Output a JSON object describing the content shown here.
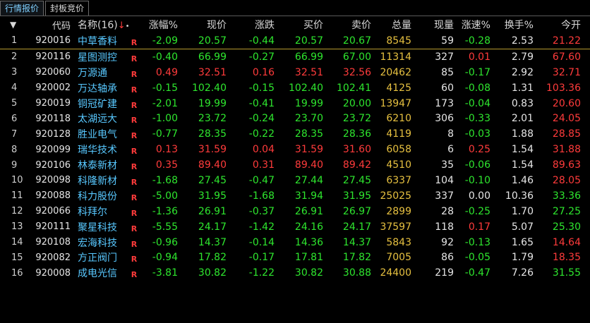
{
  "tabs": [
    {
      "label": "行情报价",
      "active": true
    },
    {
      "label": "封板竞价",
      "active": false
    }
  ],
  "header": {
    "sort_icon": "▼",
    "code": "代码",
    "name": "名称(16)",
    "sort_arrow": "↓",
    "dot": "•",
    "chg_pct": "涨幅%",
    "price": "现价",
    "diff": "涨跌",
    "bid": "买价",
    "ask": "卖价",
    "volume": "总量",
    "cur_vol": "现量",
    "speed": "涨速%",
    "turnover": "换手%",
    "open": "今开"
  },
  "colors": {
    "up": "#ff3b3b",
    "down": "#2ee62e",
    "name": "#58c8ff",
    "volume": "#e6c040",
    "selected_line": "#b69b2e"
  },
  "rows": [
    {
      "idx": "1",
      "code": "920016",
      "name": "中草香料",
      "flag": "R",
      "chg": "-2.09",
      "price": "20.57",
      "diff": "-0.44",
      "bid": "20.57",
      "ask": "20.67",
      "vol": "8545",
      "cur": "59",
      "spd": "-0.28",
      "turn": "2.53",
      "open": "21.22"
    },
    {
      "idx": "2",
      "code": "920116",
      "name": "星图测控",
      "flag": "R",
      "chg": "-0.40",
      "price": "66.99",
      "diff": "-0.27",
      "bid": "66.99",
      "ask": "67.00",
      "vol": "11314",
      "cur": "327",
      "spd": "0.01",
      "turn": "2.79",
      "open": "67.60"
    },
    {
      "idx": "3",
      "code": "920060",
      "name": "万源通",
      "flag": "R",
      "chg": "0.49",
      "price": "32.51",
      "diff": "0.16",
      "bid": "32.51",
      "ask": "32.56",
      "vol": "20462",
      "cur": "85",
      "spd": "-0.17",
      "turn": "2.92",
      "open": "32.71"
    },
    {
      "idx": "4",
      "code": "920002",
      "name": "万达轴承",
      "flag": "R",
      "chg": "-0.15",
      "price": "102.40",
      "diff": "-0.15",
      "bid": "102.40",
      "ask": "102.41",
      "vol": "4125",
      "cur": "60",
      "spd": "-0.08",
      "turn": "1.31",
      "open": "103.36"
    },
    {
      "idx": "5",
      "code": "920019",
      "name": "铜冠矿建",
      "flag": "R",
      "chg": "-2.01",
      "price": "19.99",
      "diff": "-0.41",
      "bid": "19.99",
      "ask": "20.00",
      "vol": "13947",
      "cur": "173",
      "spd": "-0.04",
      "turn": "0.83",
      "open": "20.60"
    },
    {
      "idx": "6",
      "code": "920118",
      "name": "太湖远大",
      "flag": "R",
      "chg": "-1.00",
      "price": "23.72",
      "diff": "-0.24",
      "bid": "23.70",
      "ask": "23.72",
      "vol": "6210",
      "cur": "306",
      "spd": "-0.33",
      "turn": "2.01",
      "open": "24.05"
    },
    {
      "idx": "7",
      "code": "920128",
      "name": "胜业电气",
      "flag": "R",
      "chg": "-0.77",
      "price": "28.35",
      "diff": "-0.22",
      "bid": "28.35",
      "ask": "28.36",
      "vol": "4119",
      "cur": "8",
      "spd": "-0.03",
      "turn": "1.88",
      "open": "28.85"
    },
    {
      "idx": "8",
      "code": "920099",
      "name": "瑞华技术",
      "flag": "R",
      "chg": "0.13",
      "price": "31.59",
      "diff": "0.04",
      "bid": "31.59",
      "ask": "31.60",
      "vol": "6058",
      "cur": "6",
      "spd": "0.25",
      "turn": "1.54",
      "open": "31.88"
    },
    {
      "idx": "9",
      "code": "920106",
      "name": "林泰新材",
      "flag": "R",
      "chg": "0.35",
      "price": "89.40",
      "diff": "0.31",
      "bid": "89.40",
      "ask": "89.42",
      "vol": "4510",
      "cur": "35",
      "spd": "-0.06",
      "turn": "1.54",
      "open": "89.63"
    },
    {
      "idx": "10",
      "code": "920098",
      "name": "科隆新材",
      "flag": "R",
      "chg": "-1.68",
      "price": "27.45",
      "diff": "-0.47",
      "bid": "27.44",
      "ask": "27.45",
      "vol": "6337",
      "cur": "104",
      "spd": "-0.10",
      "turn": "1.46",
      "open": "28.05"
    },
    {
      "idx": "11",
      "code": "920088",
      "name": "科力股份",
      "flag": "R",
      "chg": "-5.00",
      "price": "31.95",
      "diff": "-1.68",
      "bid": "31.94",
      "ask": "31.95",
      "vol": "25025",
      "cur": "337",
      "spd": "0.00",
      "turn": "10.36",
      "open": "33.36"
    },
    {
      "idx": "12",
      "code": "920066",
      "name": "科拜尔",
      "flag": "R",
      "chg": "-1.36",
      "price": "26.91",
      "diff": "-0.37",
      "bid": "26.91",
      "ask": "26.97",
      "vol": "2899",
      "cur": "28",
      "spd": "-0.25",
      "turn": "1.70",
      "open": "27.25"
    },
    {
      "idx": "13",
      "code": "920111",
      "name": "聚星科技",
      "flag": "R",
      "chg": "-5.55",
      "price": "24.17",
      "diff": "-1.42",
      "bid": "24.16",
      "ask": "24.17",
      "vol": "37597",
      "cur": "118",
      "spd": "0.17",
      "turn": "5.07",
      "open": "25.30"
    },
    {
      "idx": "14",
      "code": "920108",
      "name": "宏海科技",
      "flag": "R",
      "chg": "-0.96",
      "price": "14.37",
      "diff": "-0.14",
      "bid": "14.36",
      "ask": "14.37",
      "vol": "5843",
      "cur": "92",
      "spd": "-0.13",
      "turn": "1.65",
      "open": "14.64"
    },
    {
      "idx": "15",
      "code": "920082",
      "name": "方正阀门",
      "flag": "R",
      "chg": "-0.94",
      "price": "17.82",
      "diff": "-0.17",
      "bid": "17.81",
      "ask": "17.82",
      "vol": "7005",
      "cur": "86",
      "spd": "-0.05",
      "turn": "1.79",
      "open": "18.35"
    },
    {
      "idx": "16",
      "code": "920008",
      "name": "成电光信",
      "flag": "R",
      "chg": "-3.81",
      "price": "30.82",
      "diff": "-1.22",
      "bid": "30.82",
      "ask": "30.88",
      "vol": "24400",
      "cur": "219",
      "spd": "-0.47",
      "turn": "7.26",
      "open": "31.55"
    }
  ]
}
